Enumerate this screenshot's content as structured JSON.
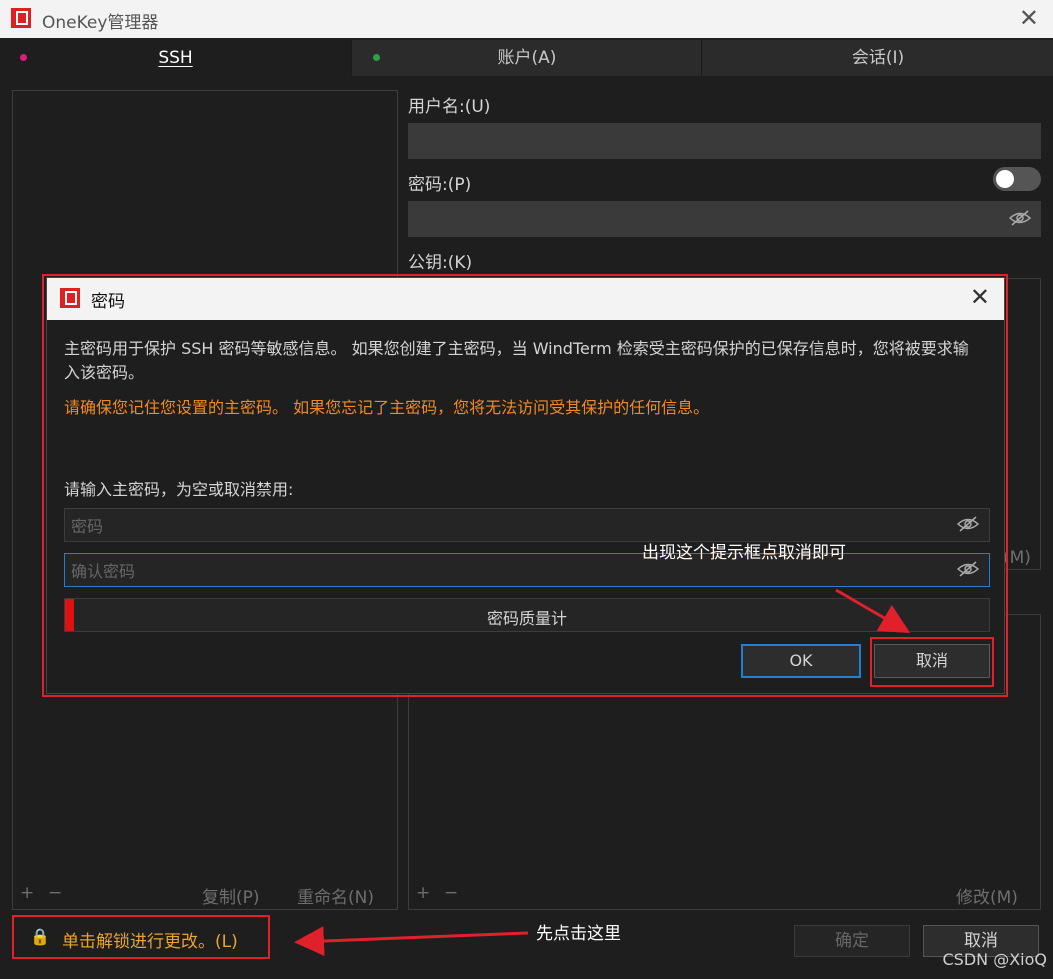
{
  "window": {
    "title": "OneKey管理器",
    "close": "✕"
  },
  "tabs": [
    {
      "label": "SSH(S)",
      "display": "SSH",
      "dot_color": "#e0197a"
    },
    {
      "label": "账户(A)",
      "display": "账户(A)",
      "dot_color": "#2ea043"
    },
    {
      "label": "会话(I)",
      "display": "会话(I)"
    }
  ],
  "left": {
    "add": "+",
    "remove": "−",
    "copy": "复制(P)",
    "rename": "重命名(N)"
  },
  "right": {
    "username_label": "用户名:(U)",
    "password_label": "密码:(P)",
    "pubkey_label": "公钥:(K)",
    "modify_hidden": "(M)",
    "add": "+",
    "remove": "−",
    "modify": "修改(M)"
  },
  "bottom": {
    "unlock_label": "单击解锁进行更改。(L)",
    "ok": "确定",
    "cancel": "取消"
  },
  "dialog": {
    "title": "密码",
    "info": "主密码用于保护 SSH 密码等敏感信息。 如果您创建了主密码，当 WindTerm 检索受主密码保护的已保存信息时，您将被要求输入该密码。",
    "warning": "请确保您记住您设置的主密码。 如果您忘记了主密码，您将无法访问受其保护的任何信息。",
    "prompt": "请输入主密码，为空或取消禁用:",
    "password_placeholder": "密码",
    "confirm_placeholder": "确认密码",
    "meter_label": "密码质量计",
    "meter_level": 0.01,
    "ok": "OK",
    "cancel": "取消"
  },
  "annotations": {
    "dialog_hint": "出现这个提示框点取消即可",
    "first_click": "先点击这里"
  },
  "watermark": "CSDN @XioQ",
  "colors": {
    "accent": "#1f7fd6",
    "annotation": "#e0202a",
    "warning": "#f08a24"
  }
}
